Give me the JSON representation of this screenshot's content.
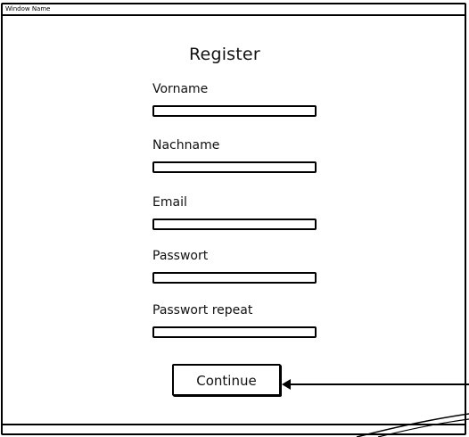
{
  "window": {
    "title": "Window Name"
  },
  "form": {
    "title": "Register",
    "fields": [
      {
        "label": "Vorname",
        "value": ""
      },
      {
        "label": "Nachname",
        "value": ""
      },
      {
        "label": "Email",
        "value": ""
      },
      {
        "label": "Passwort",
        "value": ""
      },
      {
        "label": "Passwort repeat",
        "value": ""
      }
    ],
    "continue_label": "Continue"
  }
}
